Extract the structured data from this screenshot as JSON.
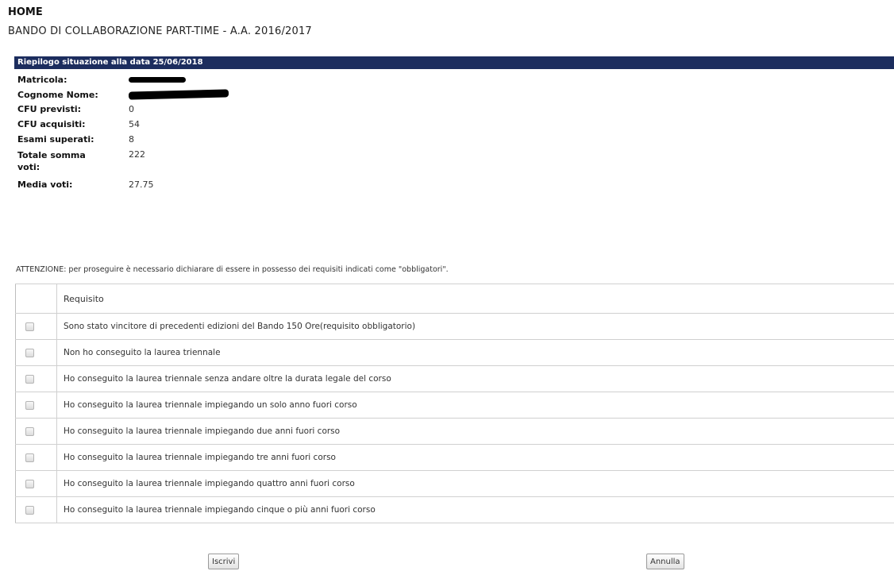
{
  "header": {
    "home": "HOME",
    "subtitle": "BANDO DI COLLABORAZIONE PART-TIME - A.A. 2016/2017"
  },
  "summary": {
    "title": "Riepilogo situazione alla data 25/06/2018",
    "rows": [
      {
        "label": "Matricola:",
        "value": ""
      },
      {
        "label": "Cognome Nome:",
        "value": ""
      },
      {
        "label": "CFU previsti:",
        "value": "0"
      },
      {
        "label": "CFU acquisiti:",
        "value": "54"
      },
      {
        "label": "Esami superati:",
        "value": "8"
      },
      {
        "label": "Totale somma voti:",
        "value": "222"
      },
      {
        "label": "Media voti:",
        "value": "27.75"
      }
    ]
  },
  "warning": "ATTENZIONE: per proseguire è necessario dichiarare di essere in possesso dei requisiti indicati come \"obbligatori\".",
  "table": {
    "header": "Requisito",
    "rows": [
      "Sono stato vincitore di precedenti edizioni del Bando 150 Ore(requisito obbligatorio)",
      "Non ho conseguito la laurea triennale",
      "Ho conseguito la laurea triennale senza andare oltre la durata legale del corso",
      "Ho conseguito la laurea triennale impiegando un solo anno fuori corso",
      "Ho conseguito la laurea triennale impiegando due anni fuori corso",
      "Ho conseguito la laurea triennale impiegando tre anni fuori corso",
      "Ho conseguito la laurea triennale impiegando quattro anni fuori corso",
      "Ho conseguito la laurea triennale impiegando cinque o più anni fuori corso"
    ]
  },
  "buttons": {
    "submit": "Iscrivi",
    "cancel": "Annulla"
  }
}
